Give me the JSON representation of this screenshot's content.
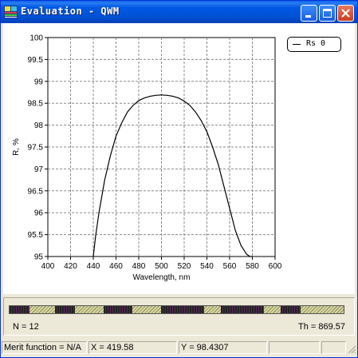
{
  "window": {
    "title": "Evaluation - QWM",
    "app_icon": "optilayer-app-icon",
    "buttons": [
      "minimize-icon",
      "maximize-icon",
      "close-icon"
    ]
  },
  "legend": {
    "label": "Rs 0"
  },
  "colors": {
    "curve": "#000000",
    "grid": "#888888",
    "title_bar": "#0054e3"
  },
  "chart_data": {
    "type": "line",
    "xlabel": "Wavelength, nm",
    "ylabel": "R, %",
    "xlim": [
      400,
      600
    ],
    "ylim": [
      95,
      100
    ],
    "xticks": [
      "400",
      "420",
      "440",
      "460",
      "480",
      "500",
      "520",
      "540",
      "560",
      "580",
      "600"
    ],
    "yticks": [
      "95",
      "95.5",
      "96",
      "96.5",
      "97",
      "97.5",
      "98",
      "98.5",
      "99",
      "99.5",
      "100"
    ],
    "grid": true,
    "legend_position": "top-right",
    "series": [
      {
        "name": "Rs 0",
        "x": [
          440,
          442,
          445,
          450,
          455,
          460,
          465,
          470,
          475,
          480,
          485,
          490,
          495,
          500,
          505,
          510,
          515,
          520,
          525,
          530,
          535,
          540,
          545,
          550,
          555,
          560,
          565,
          570,
          575,
          578,
          580
        ],
        "y": [
          95.0,
          95.45,
          96.0,
          96.75,
          97.3,
          97.75,
          98.05,
          98.3,
          98.45,
          98.56,
          98.62,
          98.66,
          98.68,
          98.69,
          98.68,
          98.66,
          98.62,
          98.55,
          98.45,
          98.3,
          98.1,
          97.85,
          97.5,
          97.1,
          96.6,
          96.1,
          95.6,
          95.25,
          95.05,
          95.0,
          95.0
        ]
      }
    ]
  },
  "layers": {
    "n_label": "N = 12",
    "th_label": "Th = 869.57",
    "segments": [
      {
        "type": "H",
        "weight": 7
      },
      {
        "type": "L",
        "weight": 9
      },
      {
        "type": "H",
        "weight": 7
      },
      {
        "type": "L",
        "weight": 10
      },
      {
        "type": "H",
        "weight": 10
      },
      {
        "type": "L",
        "weight": 10
      },
      {
        "type": "H",
        "weight": 15
      },
      {
        "type": "L",
        "weight": 6
      },
      {
        "type": "H",
        "weight": 15
      },
      {
        "type": "L",
        "weight": 6
      },
      {
        "type": "H",
        "weight": 7
      },
      {
        "type": "L",
        "weight": 15
      }
    ],
    "colors": {
      "H": "#222222",
      "L": "#d8d8a0"
    }
  },
  "status": {
    "merit": "Merit function = N/A",
    "x_readout": "X = 419.58",
    "y_readout": "Y = 98.4307",
    "field4": "",
    "field5": ""
  }
}
